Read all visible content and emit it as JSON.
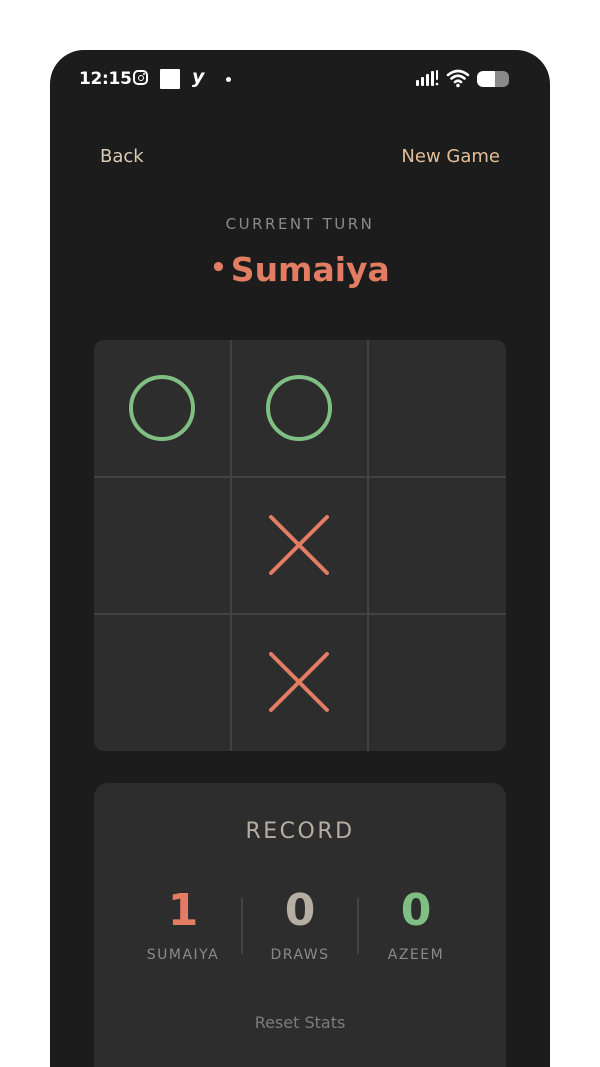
{
  "status_bar": {
    "time": "12:15",
    "app_icon_glyph": "y",
    "battery_level": 0.55
  },
  "header": {
    "back_label": "Back",
    "new_game_label": "New Game"
  },
  "turn": {
    "label": "CURRENT TURN",
    "bullet": "•",
    "player": "Sumaiya"
  },
  "board": {
    "cells": [
      "O",
      "O",
      "",
      "",
      "X",
      "",
      "",
      "X",
      ""
    ],
    "o_color": "#7fbf84",
    "x_color": "#e27d63"
  },
  "record": {
    "title": "RECORD",
    "stats": [
      {
        "value": "1",
        "label": "SUMAIYA",
        "color": "#e27d63"
      },
      {
        "value": "0",
        "label": "DRAWS",
        "color": "#b6ada3"
      },
      {
        "value": "0",
        "label": "AZEEM",
        "color": "#7fbf84"
      }
    ],
    "reset_label": "Reset Stats"
  }
}
